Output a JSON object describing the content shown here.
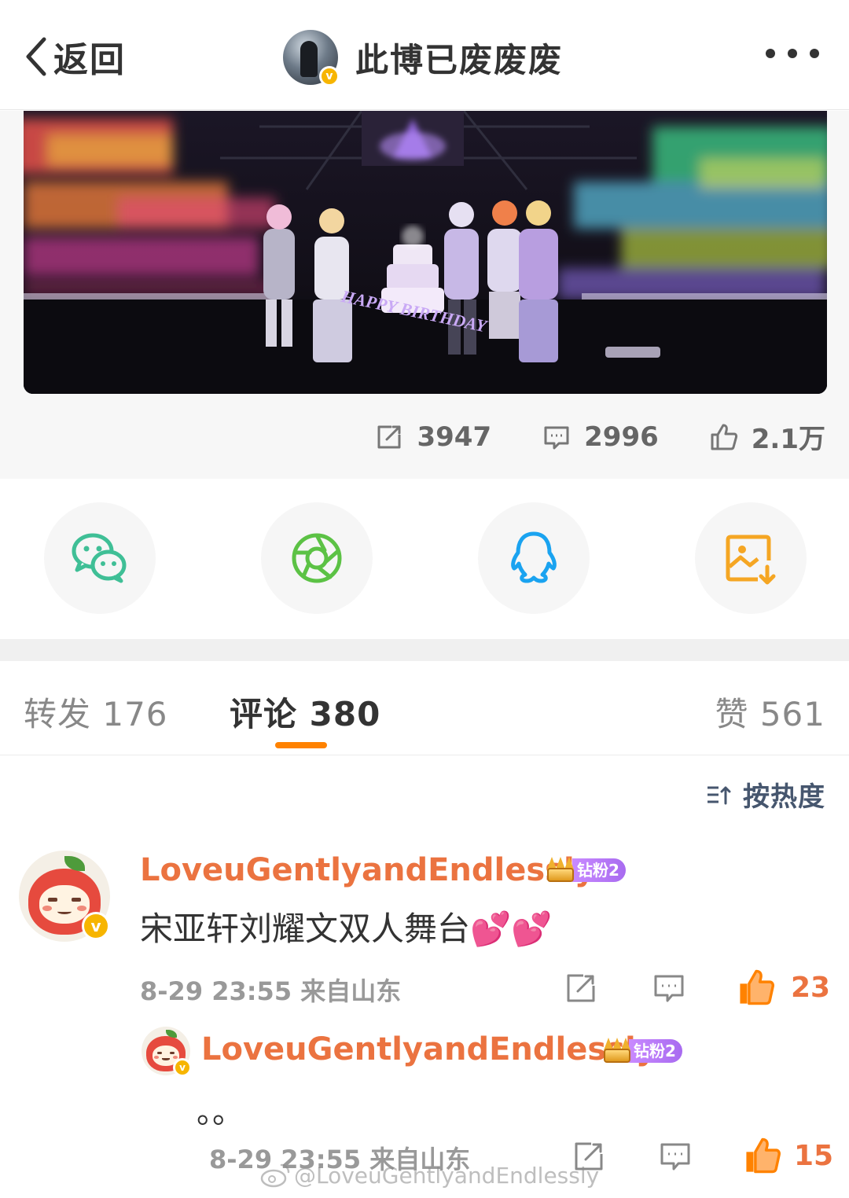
{
  "header": {
    "back_label": "返回",
    "author_name": "此博已废废废",
    "avatar_icon": "penguin-avatar",
    "more_icon": "more-dots-icon"
  },
  "post": {
    "image_icon": "concert-stage-photo",
    "photo_text": "HAPPY BIRTHDAY",
    "stats": {
      "reposts": "3947",
      "comments": "2996",
      "likes": "2.1万"
    }
  },
  "share": [
    {
      "name": "wechat",
      "icon": "wechat-icon",
      "color": "#3fbf96"
    },
    {
      "name": "moments",
      "icon": "wechat-moments-icon",
      "color": "#5cc245"
    },
    {
      "name": "qq",
      "icon": "qq-icon",
      "color": "#1aa3f0"
    },
    {
      "name": "save-image",
      "icon": "save-image-icon",
      "color": "#f5a623"
    }
  ],
  "tabs": {
    "repost": "转发 176",
    "comment": "评论 380",
    "like": "赞 561",
    "active_color": "#ff8200"
  },
  "sort": {
    "label": "按热度",
    "icon": "sort-icon"
  },
  "comments": [
    {
      "username": "LoveuGentlyandEndlessly",
      "fan_badge": "钻粉2",
      "text": "宋亚轩刘耀文双人舞台💕💕",
      "meta": "8-29 23:55 来自山东",
      "likes": "23"
    }
  ],
  "replies": [
    {
      "username": "LoveuGentlyandEndlessly",
      "fan_badge": "钻粉2",
      "text": "。。",
      "meta": "8-29 23:55 来自山东",
      "likes": "15"
    }
  ],
  "watermark": "@LoveuGentlyandEndlessly",
  "colors": {
    "username": "#eb7340",
    "like_active": "#ff8200",
    "sort_text": "#46566e"
  }
}
